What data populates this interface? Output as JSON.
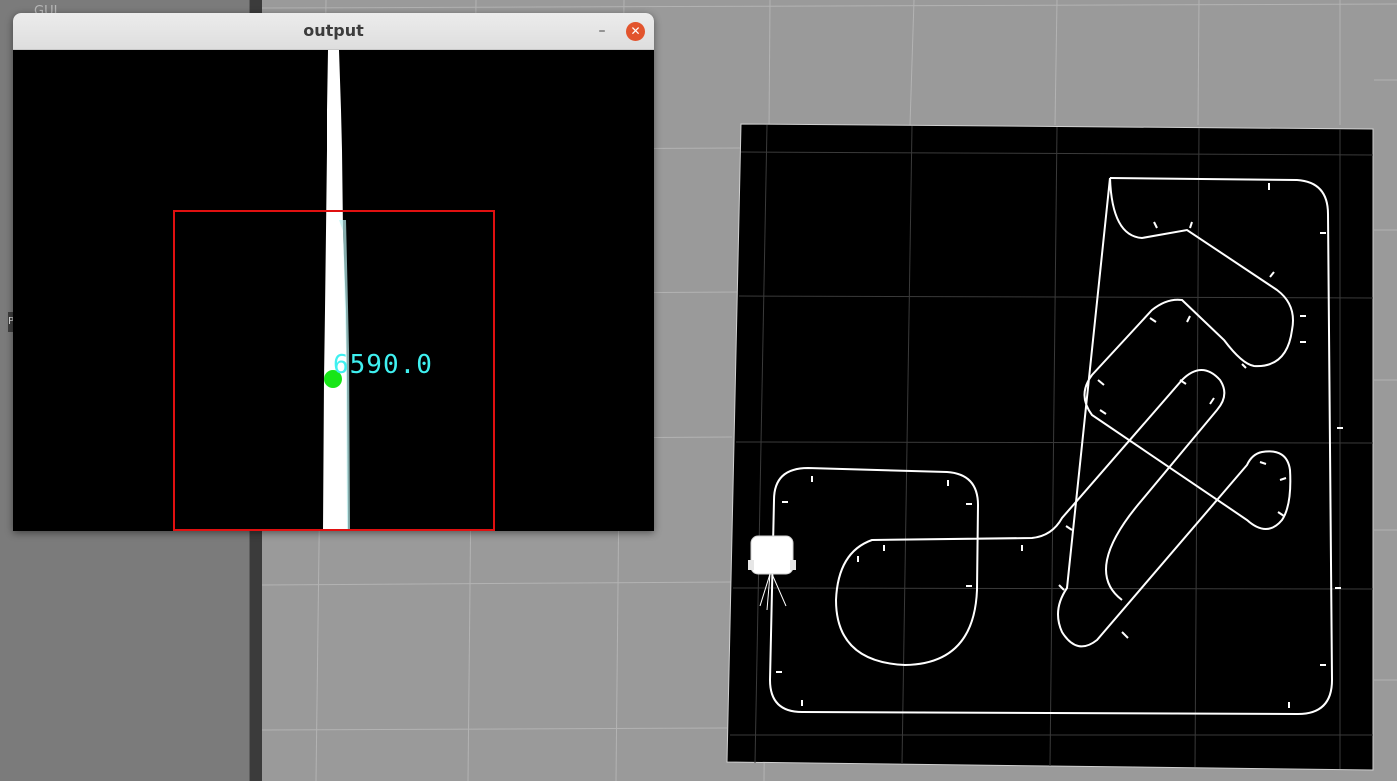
{
  "side_panel": {
    "label": "GUI",
    "handle_label": "P"
  },
  "output_window": {
    "title": "output",
    "minimize_label": "–",
    "close_label": "✕",
    "error_value": "6590.0",
    "colors": {
      "roi_box": "#e01010",
      "centroid": "#17e617",
      "text": "#3ff0f0",
      "lane": "#ffffff"
    }
  },
  "scene": {
    "ground_color": "#9a9a9a",
    "track_board_color": "#000000",
    "track_line_color": "#ffffff"
  },
  "icons": {
    "minimize": "minimize-icon",
    "close": "close-icon",
    "robot": "robot-model"
  }
}
